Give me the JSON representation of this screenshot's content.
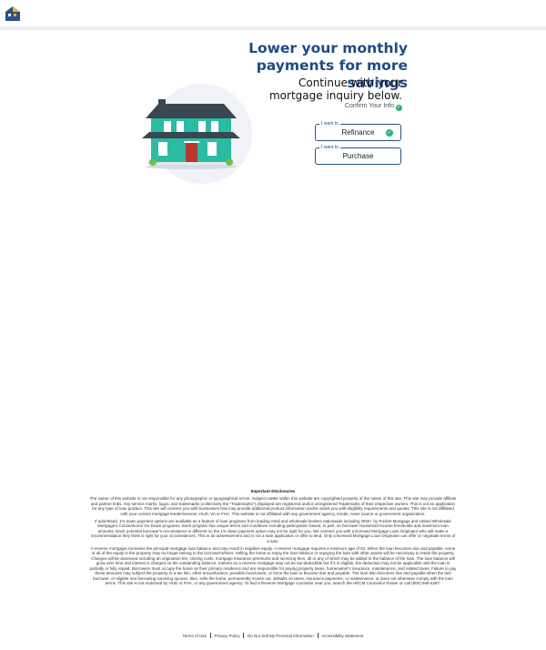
{
  "header": {
    "logo_icon": "house-logo-icon"
  },
  "hero": {
    "title": "Lower your monthly payments for more savings",
    "subtitle": "Continue with your mortgage inquiry below.",
    "confirm": "Confirm Your Info"
  },
  "options": [
    {
      "legend": "I want to",
      "value": "Refinance",
      "selected": true
    },
    {
      "legend": "I want to",
      "value": "Purchase",
      "selected": false
    }
  ],
  "disclosures": {
    "heading": "Important Disclosures",
    "p1": "The owner of this website is not responsible for any photographic or typographical errors. Subject matter within this website are copyrighted property of the owner of this site. This site may provide affiliate and partner links. Any service marks, logos, and trademarks (collectively the \"Trademarks\") displayed are registered and/or unregistered Trademarks of their respective owners. This is not an application for any type of loan product. This site will connect you with businesses that may provide additional product information and/or assist you with eligibility requirements and quotes. This site is not affiliated with your current mortgage lender/servicer, HUD, VA or FHA. This website is not affiliated with any government agency, lender, news source or government organization.",
    "p2": "If advertised, 1% down payment options are available as a feature of loan programs from leading retail and wholesale lenders nationwide including ONE+ by Rocket Mortgage and United Wholesale Mortgage's Conventional 1% Down programs. Each program has unique terms and conditions including participation based, in part, on borrower household income thresholds and maximum loan amounts. Each potential borrower's circumstance is different so the 1% down payment option may not be right for you. We connect you with a licensed Mortgage Loan Originator who will make a recommendation they think is right for your circumstances. This is an advertisement and is not a loan application or offer to lend. Only a licensed Mortgage Loan Originator can offer or negotiate terms of a loan.",
    "p3": "A reverse mortgage increases the principal mortgage loan balance and may result in negative equity. A reverse mortgage requires a minimum age of 62. When the loan becomes due and payable, some or all of the equity in the property may no longer belong to the borrower's/heirs. Selling the home to repay the loan balance or repaying the loan with other assets will be necessary to retain the property. Charges will be assessed including an origination fee, closing costs, mortgage insurance premiums and servicing fees, all or any of which may be added to the balance of the loan. The loan balance will grow over time and interest is charged on the outstanding balance. Interest on a reverse mortgage may not be tax-deductible but if it is eligible, the deduction may not be applicable until the loan is partially or fully repaid. Borrowers must occupy the home as their primary residence and are responsible for paying property taxes, homeowner's insurance, maintenance, and related taxes. Failure to pay these amounts may subject the property to a tax lien, other encumbrance, possible foreclosure, or force the loan to become due and payable. The loan also becomes due and payable when the last borrower, or eligible non borrowing surviving spouse, dies, sells the home, permanently moves out, defaults on taxes, insurance payments, or maintenance, or does not otherwise comply with the loan terms. This site is not endorsed by HUD or FHA, or any government agency. To find a Reverse Mortgage counselor near you, search the HECM Counselor Roster or call (800) 569-4287."
  },
  "footer": {
    "links": [
      "Terms of Use",
      "Privacy Policy",
      "Do Not Sell My Personal Information",
      "Accessibility Statement"
    ]
  },
  "colors": {
    "brand": "#1e4a86",
    "accent_green": "#27b86b",
    "border": "#2a5188"
  }
}
